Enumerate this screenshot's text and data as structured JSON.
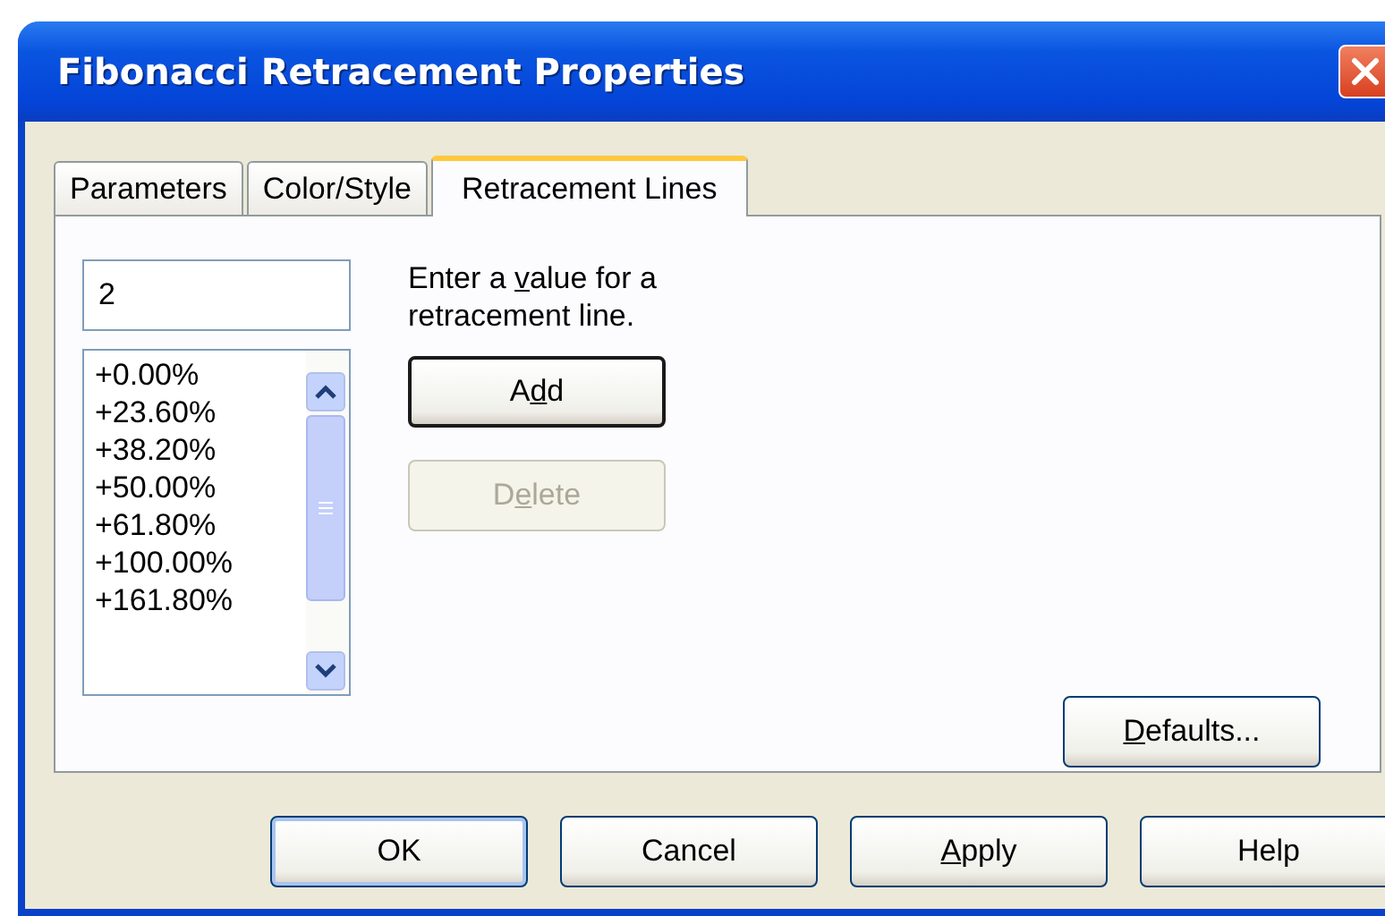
{
  "window": {
    "title": "Fibonacci Retracement Properties"
  },
  "tabs": [
    {
      "label": "Parameters",
      "selected": false
    },
    {
      "label": "Color/Style",
      "selected": false
    },
    {
      "label": "Retracement Lines",
      "selected": true
    }
  ],
  "value_field": {
    "value": "2"
  },
  "levels": [
    {
      "label": "+0.00%"
    },
    {
      "label": "+23.60%"
    },
    {
      "label": "+38.20%"
    },
    {
      "label": "+50.00%"
    },
    {
      "label": "+61.80%"
    },
    {
      "label": "+100.00%"
    },
    {
      "label": "+161.80%"
    }
  ],
  "hint": {
    "before": "Enter a ",
    "access_key": "v",
    "after": "alue for a retracement line."
  },
  "actions": [
    {
      "before": "A",
      "access_key": "d",
      "after": "d",
      "disabled": false,
      "default": true
    },
    {
      "before": "D",
      "access_key": "e",
      "after": "lete",
      "disabled": true,
      "default": false
    }
  ],
  "defaults_button": {
    "access_key": "D",
    "after": "efaults..."
  },
  "buttons": [
    {
      "label": "OK",
      "default": true
    },
    {
      "label": "Cancel",
      "default": false
    },
    {
      "access_key": "A",
      "after": "pply",
      "default": false
    },
    {
      "label": "Help",
      "default": false
    }
  ]
}
